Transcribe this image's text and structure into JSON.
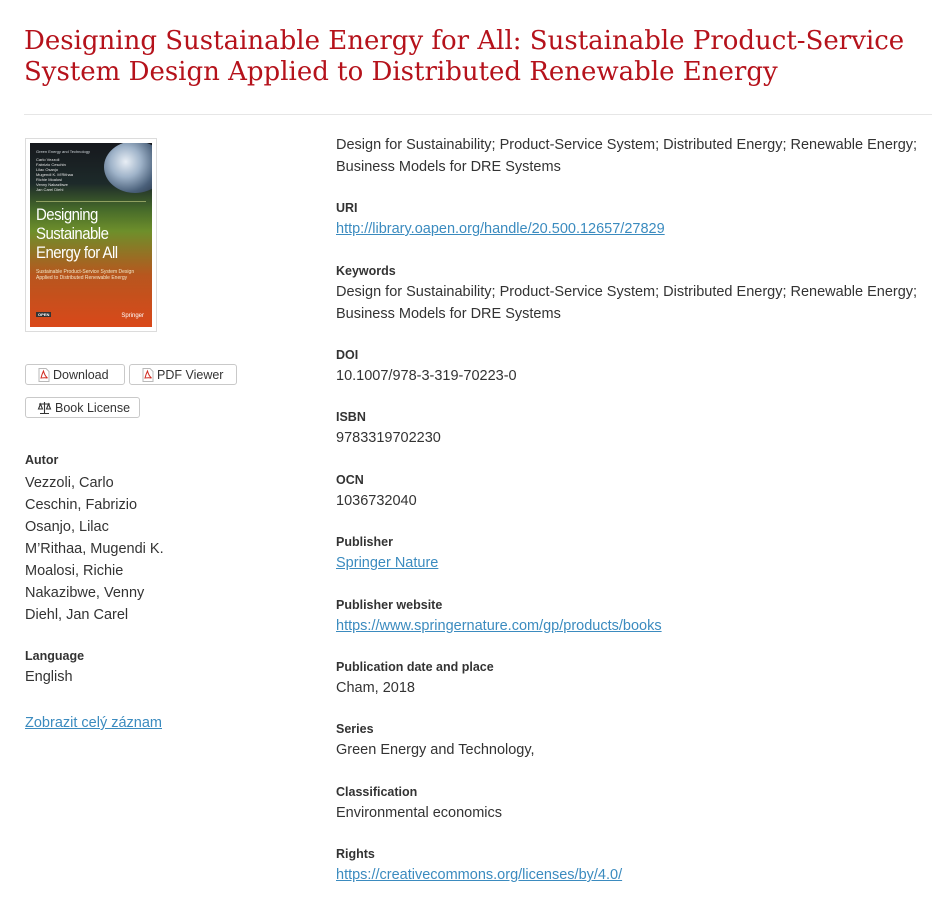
{
  "title": "Designing Sustainable Energy for All: Sustainable Product-Service System Design Applied to Distributed Renewable Energy",
  "cover": {
    "series": "Green Energy and Technology",
    "authors": [
      "Carlo Vezzoli",
      "Fabrizio Ceschin",
      "Lilac Osanjo",
      "Mugendi K. M'Rithaa",
      "Richie Moalosi",
      "Venny Nakazibwe",
      "Jan Carel Diehl"
    ],
    "title": "Designing Sustainable Energy for All",
    "subtitle": "Sustainable Product-Service System Design Applied to Distributed Renewable Energy",
    "open_badge": "OPEN",
    "publisher": "Springer"
  },
  "buttons": {
    "download": "Download",
    "pdf_viewer": "PDF Viewer",
    "book_license": "Book License"
  },
  "left": {
    "authors_label": "Autor",
    "authors": [
      "Vezzoli, Carlo",
      "Ceschin, Fabrizio",
      "Osanjo, Lilac",
      "M’Rithaa, Mugendi K.",
      "Moalosi, Richie",
      "Nakazibwe, Venny",
      "Diehl, Jan Carel"
    ],
    "language_label": "Language",
    "language": "English",
    "full_record_link": "Zobrazit celý záznam"
  },
  "summary": "Design for Sustainability; Product-Service System; Distributed Energy; Renewable Energy; Business Models for DRE Systems",
  "fields": {
    "uri_label": "URI",
    "uri": "http://library.oapen.org/handle/20.500.12657/27829",
    "keywords_label": "Keywords",
    "keywords": "Design for Sustainability; Product-Service System; Distributed Energy; Renewable Energy; Business Models for DRE Systems",
    "doi_label": "DOI",
    "doi": "10.1007/978-3-319-70223-0",
    "isbn_label": "ISBN",
    "isbn": "9783319702230",
    "ocn_label": "OCN",
    "ocn": "1036732040",
    "publisher_label": "Publisher",
    "publisher": "Springer Nature",
    "publisher_website_label": "Publisher website",
    "publisher_website": "https://www.springernature.com/gp/products/books",
    "pubdate_label": "Publication date and place",
    "pubdate": "Cham, 2018",
    "series_label": "Series",
    "series": "Green Energy and Technology,",
    "classification_label": "Classification",
    "classification": "Environmental economics",
    "rights_label": "Rights",
    "rights": "https://creativecommons.org/licenses/by/4.0/"
  },
  "colors": {
    "title": "#b5121b",
    "link": "#3b8bbf",
    "text": "#333333"
  }
}
